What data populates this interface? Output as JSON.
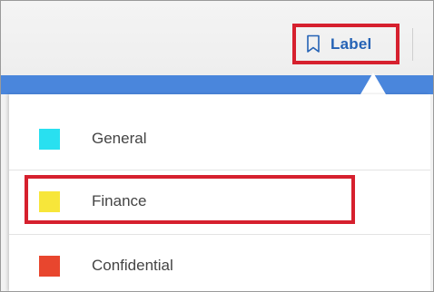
{
  "toolbar": {
    "label_button": {
      "text": "Label",
      "icon": "bookmark-icon"
    }
  },
  "colors": {
    "accent_bar": "#4a86dc",
    "highlight_border": "#d6202e",
    "label_text": "#2462b5"
  },
  "dropdown": {
    "items": [
      {
        "label": "General",
        "color": "#29e0f0"
      },
      {
        "label": "Finance",
        "color": "#f7e63a"
      },
      {
        "label": "Confidential",
        "color": "#e8462e"
      }
    ],
    "highlighted_index": 1
  }
}
